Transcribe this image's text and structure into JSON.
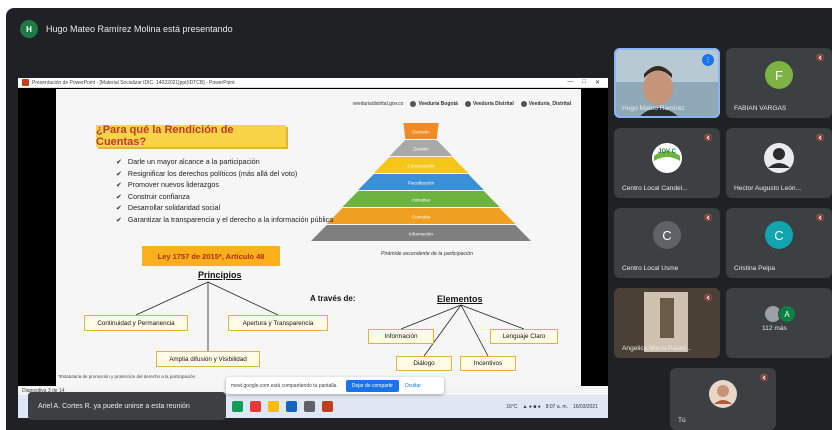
{
  "presenter_bar": {
    "avatar_letter": "H",
    "text": "Hugo Mateo Ramírez Molina está presentando"
  },
  "shared_screen": {
    "window_title": "Presentación de PowerPoint - [Material Socializar IDIC. 14032021]ppt(IDTCB] - PowerPoint",
    "window_controls": [
      "—",
      "□",
      "✕"
    ],
    "slide": {
      "header_url": "veeduriadistrital.gov.co",
      "logos": [
        "Veeduría Bogotá",
        "Veeduría Distrital",
        "Veeduría_Distrital"
      ],
      "question": "¿Para qué la Rendición de Cuentas?",
      "bullets": [
        "Darle un mayor alcance a la participación",
        "Resignificar los derechos políticos (más allá del voto)",
        "Promover nuevos liderazgos",
        "Construir confianza",
        "Desarrollar solidaridad social",
        "Garantizar la transparencia y el derecho a la información pública"
      ],
      "pyramid_levels": [
        {
          "label": "Decisión",
          "color": "#f08a24"
        },
        {
          "label": "Gestión",
          "color": "#a9a9a9"
        },
        {
          "label": "Concertación",
          "color": "#f5c518"
        },
        {
          "label": "Fiscalización",
          "color": "#3a8fd6"
        },
        {
          "label": "Iniciativa",
          "color": "#6cb33f"
        },
        {
          "label": "Consulta",
          "color": "#f0a020"
        },
        {
          "label": "Información",
          "color": "#7f7f7f"
        }
      ],
      "pyramid_caption": "Pirámide ascendente de la participación",
      "law": "Ley 1757 de 2015*, Artículo 48",
      "principios_title": "Principios",
      "principios": [
        "Continuidad y Permanencia",
        "Apertura y Transparencia",
        "Amplia difusión y Visibilidad"
      ],
      "a_traves": "A través de:",
      "elementos_title": "Elementos",
      "elementos": [
        "Información",
        "Lenguaje Claro",
        "Diálogo",
        "Incentivos"
      ],
      "footnote": "*Estatutaria de promoción y protección del derecho a la participación"
    },
    "status_bar": "Diapositiva 3 de 14",
    "share_notice": {
      "text": "meet.google.com está compartiendo tu pantalla.",
      "stop": "Dejar de compartir",
      "hide": "Ocultar"
    },
    "taskbar": {
      "icon_colors": [
        "#1a73e8",
        "#0f9d58",
        "#e53935",
        "#fbbc04",
        "#1565c0",
        "#5f6368",
        "#c43e1c"
      ],
      "weather": "16°C",
      "time": "8:07 a. m.",
      "date": "16/03/2021"
    }
  },
  "toast": "Ariel A. Cortes R. ya puede unirse a esta reunión",
  "participants": [
    {
      "name": "Hugo Mateo Ramírez",
      "type": "video",
      "speaking": true
    },
    {
      "name": "FABIAN VARGAS",
      "type": "avatar",
      "letter": "F",
      "color": "#7cb342"
    },
    {
      "name": "Centro Local Candel...",
      "type": "logo"
    },
    {
      "name": "Hector Augusto León...",
      "type": "photo"
    },
    {
      "name": "Centro Local Usme",
      "type": "avatar",
      "letter": "C",
      "color": "#5f6368"
    },
    {
      "name": "Cristina Peipa",
      "type": "avatar",
      "letter": "C",
      "color": "#12a4af"
    },
    {
      "name": "Angelica María Palaci...",
      "type": "video"
    },
    {
      "name": "112 más",
      "type": "more",
      "letter": "A",
      "color": "#0b8043"
    },
    {
      "name": "Tú",
      "type": "self"
    }
  ]
}
